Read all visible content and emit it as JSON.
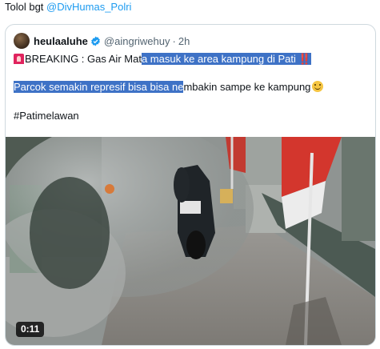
{
  "tweet": {
    "text_prefix": "Tolol bgt",
    "mention": "@DivHumas_Polri"
  },
  "quote": {
    "author_name": "heulaaluhe",
    "author_handle": "@aingriwehuy",
    "separator": "·",
    "time": "2h",
    "line1_plain": "BREAKING : Gas Air Mat",
    "line1_highlight": "a masuk ke area kampung di Pati",
    "line1_emoji": "‼️",
    "line2_highlight": "Parcok semakin represif bisa bisa ne",
    "line2_plain": "mbakin sampe ke kampung",
    "hashtag": "#Patimelawan",
    "video_duration": "0:11"
  },
  "colors": {
    "link": "#1d9bf0",
    "highlight": "#3e72c6",
    "border": "#cfd9de",
    "muted": "#536471"
  },
  "icons": [
    "verified-icon",
    "siren-icon",
    "double-exclamation-icon",
    "smile-emoji-icon"
  ]
}
